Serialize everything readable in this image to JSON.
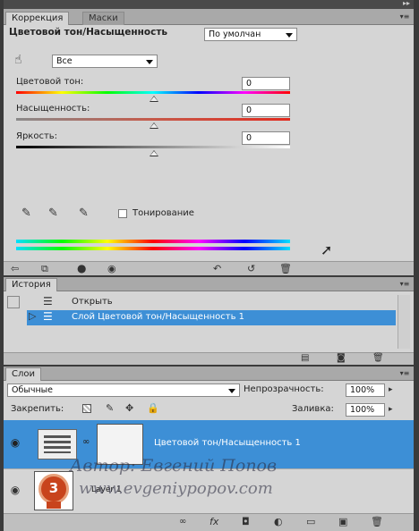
{
  "adjustments": {
    "tabs": [
      {
        "label": "Коррекция"
      },
      {
        "label": "Маски"
      }
    ],
    "title": "Цветовой тон/Насыщенность",
    "preset": "По умолчан",
    "channel": "Все",
    "sliders": [
      {
        "label": "Цветовой тон:",
        "value": "0"
      },
      {
        "label": "Насыщенность:",
        "value": "0"
      },
      {
        "label": "Яркость:",
        "value": "0"
      }
    ],
    "colorize_label": "Тонирование"
  },
  "history": {
    "title": "История",
    "items": [
      {
        "label": "Открыть"
      },
      {
        "label": "Слой Цветовой тон/Насыщенность 1"
      }
    ]
  },
  "layers": {
    "title": "Слои",
    "blend_mode": "Обычные",
    "opacity_label": "Непрозрачность:",
    "opacity_value": "100%",
    "lock_label": "Закрепить:",
    "fill_label": "Заливка:",
    "fill_value": "100%",
    "items": [
      {
        "name": "Цветовой тон/Насыщенность 1"
      },
      {
        "name": "Layer 1",
        "badge": "3"
      }
    ]
  },
  "watermark": {
    "line1": "Автор: Евгений Попов",
    "line2": "www.evgeniypopov.com"
  },
  "colors": {
    "selection": "#3d8fd6",
    "panel_bg": "#d5d5d5"
  }
}
